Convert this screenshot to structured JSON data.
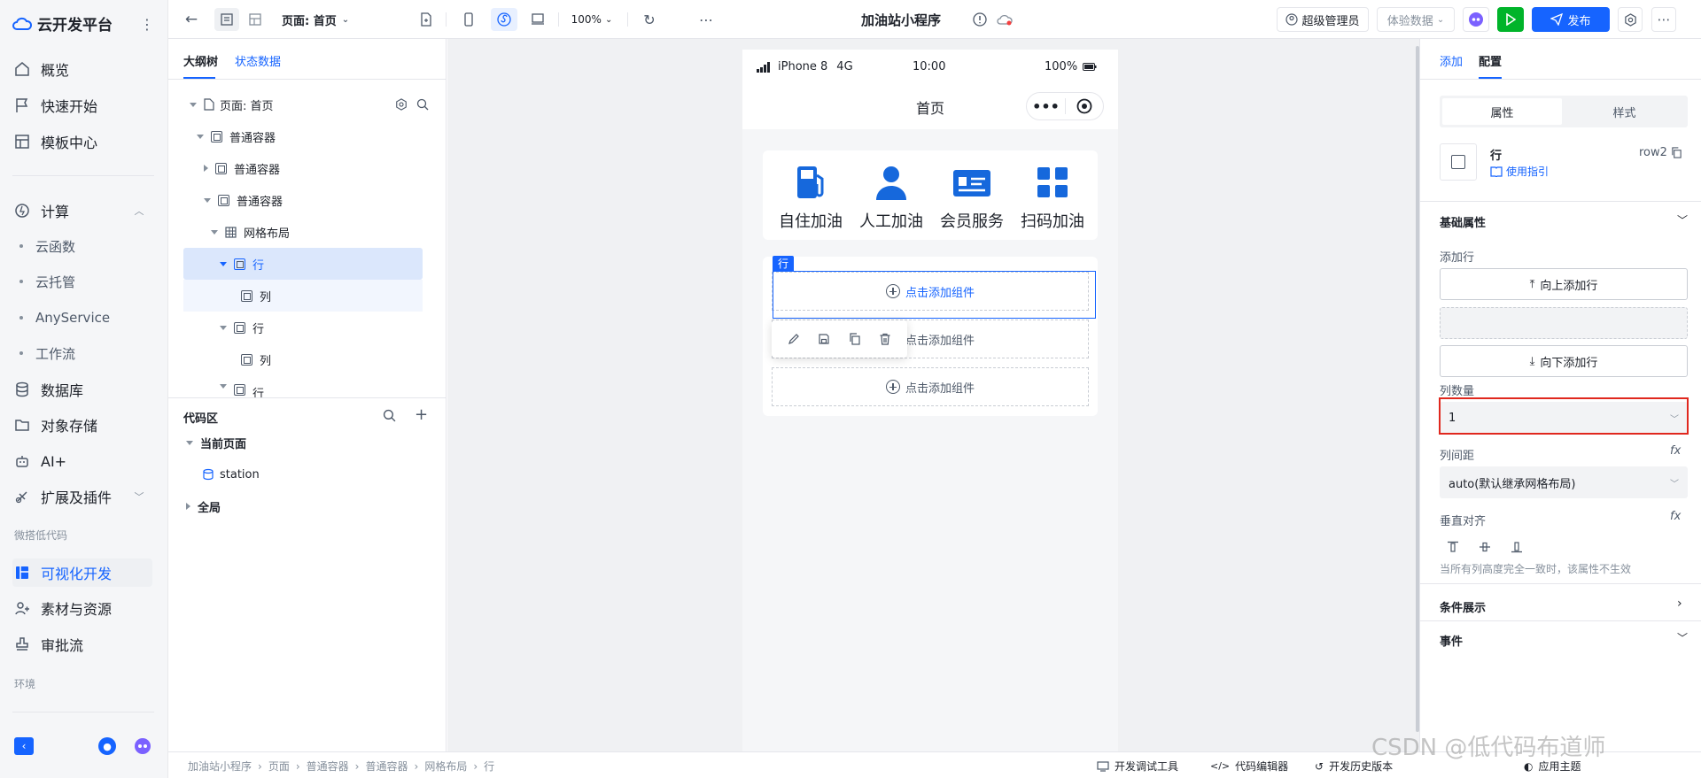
{
  "sidebar": {
    "title": "云开发平台",
    "items": {
      "overview": "概览",
      "quickstart": "快速开始",
      "templates": "模板中心",
      "compute": "计算",
      "cloudfn": "云函数",
      "hosting": "云托管",
      "anyservice": "AnyService",
      "workflow": "工作流",
      "database": "数据库",
      "storage": "对象存储",
      "ai": "AI+",
      "ext": "扩展及插件",
      "section_lowcode": "微搭低代码",
      "visual": "可视化开发",
      "assets": "素材与资源",
      "approval": "审批流",
      "section_env": "环境"
    }
  },
  "toolbar": {
    "page_label": "页面: 首页",
    "zoom": "100%",
    "app_title": "加油站小程序",
    "admin": "超级管理员",
    "trial": "体验数据",
    "publish": "发布"
  },
  "tree": {
    "tab_outline": "大纲树",
    "tab_state": "状态数据",
    "rows": [
      "页面: 首页",
      "普通容器",
      "普通容器",
      "普通容器",
      "网格布局",
      "行",
      "列",
      "行",
      "列",
      "行"
    ]
  },
  "code": {
    "title": "代码区",
    "current_page": "当前页面",
    "station": "station",
    "global": "全局"
  },
  "phone": {
    "carrier": "iPhone 8",
    "network": "4G",
    "time": "10:00",
    "battery": "100%",
    "page_title": "首页",
    "icons": [
      {
        "label": "自住加油",
        "icon": "fuel-pump-icon"
      },
      {
        "label": "人工加油",
        "icon": "person-icon"
      },
      {
        "label": "会员服务",
        "icon": "member-card-icon"
      },
      {
        "label": "扫码加油",
        "icon": "grid-icon"
      }
    ],
    "row_tag": "行",
    "add_component": "点击添加组件"
  },
  "right": {
    "tab_add": "添加",
    "tab_config": "配置",
    "tab_attr": "属性",
    "tab_style": "样式",
    "comp_name": "行",
    "comp_id": "row2",
    "guide": "使用指引",
    "basic": "基础属性",
    "add_row": "添加行",
    "add_up": "向上添加行",
    "add_down": "向下添加行",
    "col_count_label": "列数量",
    "col_count_value": "1",
    "col_gap_label": "列间距",
    "col_gap_value": "auto(默认继承网格布局)",
    "valign_label": "垂直对齐",
    "valign_hint": "当所有列高度完全一致时，该属性不生效",
    "cond": "条件展示",
    "event": "事件",
    "fx": "fx"
  },
  "bottom": {
    "crumbs": [
      "加油站小程序",
      "页面",
      "普通容器",
      "普通容器",
      "网格布局",
      "行"
    ],
    "debug": "开发调试工具",
    "editor": "代码编辑器",
    "history": "开发历史版本",
    "theme": "应用主题",
    "watermark": "CSDN @低代码布道师"
  },
  "colors": {
    "accent": "#1668dc",
    "publish": "#1664ff",
    "run": "#00b42a",
    "highlight_red": "#e0281e"
  }
}
